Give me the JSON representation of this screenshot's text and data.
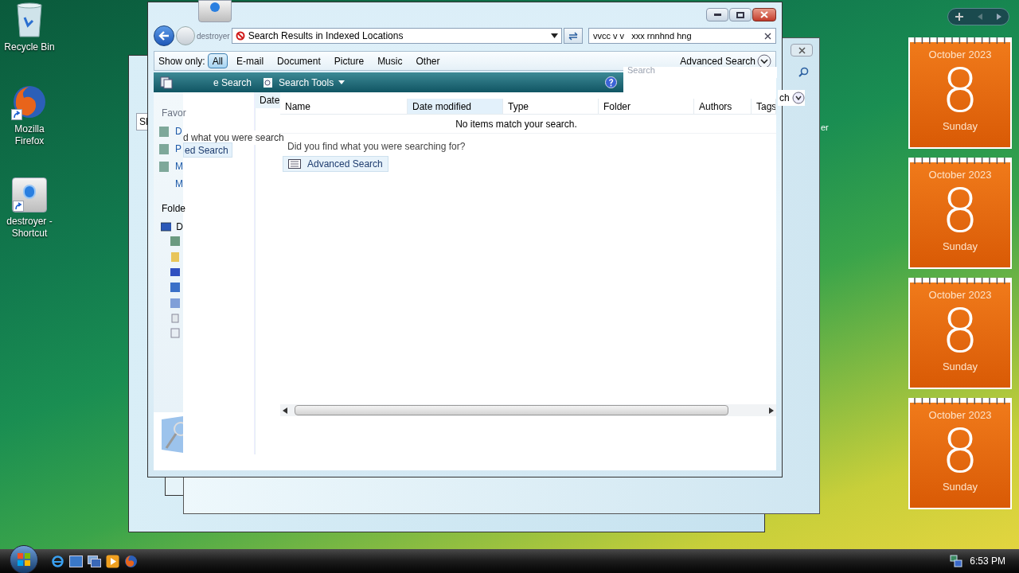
{
  "desktop_icons": [
    {
      "label": "Recycle Bin",
      "kind": "recycle"
    },
    {
      "label": "Mozilla Firefox",
      "kind": "firefox"
    },
    {
      "label": "destroyer - Shortcut",
      "kind": "app"
    }
  ],
  "back_windows": {
    "left_fragment": "Sl",
    "right_fragment": "er",
    "button_fragment": "ch",
    "search_placeholder": "Search"
  },
  "window": {
    "title": "destroyer",
    "address": "Search Results in Indexed Locations",
    "search_value": "vvcc v v   xxx rnnhnd hng",
    "show_only_label": "Show only:",
    "filters": [
      {
        "label": "All",
        "selected": true
      },
      {
        "label": "E-mail",
        "selected": false
      },
      {
        "label": "Document",
        "selected": false
      },
      {
        "label": "Picture",
        "selected": false
      },
      {
        "label": "Music",
        "selected": false
      },
      {
        "label": "Other",
        "selected": false
      }
    ],
    "advanced_toggle": "Advanced Search",
    "columns": [
      {
        "label": "Name",
        "sorted": false
      },
      {
        "label": "Date modified",
        "sorted": true
      },
      {
        "label": "Type",
        "sorted": false
      },
      {
        "label": "Folder",
        "sorted": false
      },
      {
        "label": "Authors",
        "sorted": false
      },
      {
        "label": "Tags",
        "sorted": false
      }
    ],
    "empty_message": "No items match your search.",
    "prompt": "Did you find what you were searching for?",
    "advanced_button": "Advanced Search"
  },
  "ghost_pane": {
    "toolbar_items": [
      "e Search",
      "Search Tools"
    ],
    "column": "Date",
    "favorites_heading": "Favor",
    "favorites": [
      "D",
      "P",
      "M",
      "M"
    ],
    "folders_heading": "Folde",
    "folders": [
      "D"
    ],
    "prompt_fragment": "d what you were search",
    "button_fragment": "ed Search"
  },
  "gadgets": [
    {
      "month": "October 2023",
      "day": "8",
      "weekday": "Sunday"
    },
    {
      "month": "October 2023",
      "day": "8",
      "weekday": "Sunday"
    },
    {
      "month": "October 2023",
      "day": "8",
      "weekday": "Sunday"
    },
    {
      "month": "October 2023",
      "day": "8",
      "weekday": "Sunday"
    }
  ],
  "clock": "6:53 PM"
}
